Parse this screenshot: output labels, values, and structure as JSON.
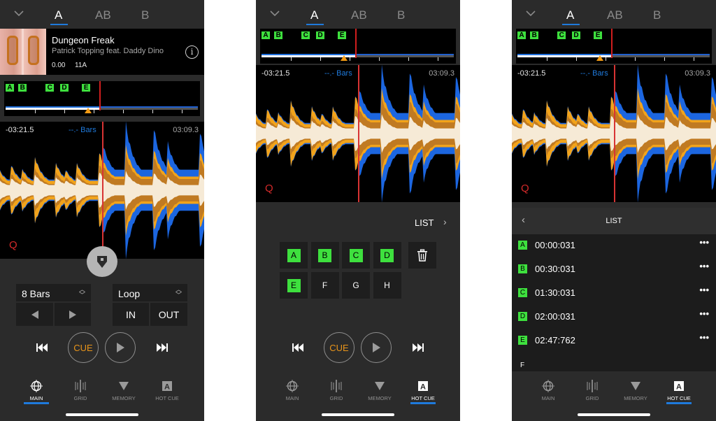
{
  "deck_tabs": {
    "collapse_icon": "chevron-down-icon",
    "tabs": [
      "A",
      "AB",
      "B"
    ],
    "active": "A"
  },
  "track": {
    "title": "Dungeon Freak",
    "artist": "Patrick Topping feat. Daddy Dino",
    "bpm": "0.00",
    "key": "11A",
    "info_icon": "info-icon"
  },
  "overview": {
    "hot_cues": [
      "A",
      "B",
      "C",
      "D",
      "E"
    ],
    "progress": 0.485
  },
  "waveform": {
    "elapsed": "-03:21.5",
    "bars": "--.- Bars",
    "remaining": "03:09.3",
    "quantize": "Q"
  },
  "main_panel": {
    "beat_select": "8 Bars",
    "loop_select": "Loop",
    "loop_in": "IN",
    "loop_out": "OUT"
  },
  "transport": {
    "cue": "CUE"
  },
  "nav": {
    "items": [
      {
        "label": "MAIN",
        "icon": "globe-icon"
      },
      {
        "label": "GRID",
        "icon": "grid-icon"
      },
      {
        "label": "MEMORY",
        "icon": "memory-triangle-icon"
      },
      {
        "label": "HOT CUE",
        "icon": "hot-cue-icon",
        "glyph": "A"
      }
    ]
  },
  "screens": [
    {
      "active_nav": "MAIN"
    },
    {
      "active_nav": "HOT CUE"
    },
    {
      "active_nav": "HOT CUE"
    }
  ],
  "hotcue_panel": {
    "list_label": "LIST",
    "pads": [
      {
        "label": "A",
        "set": true
      },
      {
        "label": "B",
        "set": true
      },
      {
        "label": "C",
        "set": true
      },
      {
        "label": "D",
        "set": true
      },
      {
        "label": "E",
        "set": true
      },
      {
        "label": "F",
        "set": false
      },
      {
        "label": "G",
        "set": false
      },
      {
        "label": "H",
        "set": false
      }
    ],
    "delete_icon": "trash-icon"
  },
  "list_panel": {
    "title": "LIST",
    "rows": [
      {
        "label": "A",
        "time": "00:00:031",
        "more": "•••"
      },
      {
        "label": "B",
        "time": "00:30:031",
        "more": "•••"
      },
      {
        "label": "C",
        "time": "01:30:031",
        "more": "•••"
      },
      {
        "label": "D",
        "time": "02:00:031",
        "more": "•••"
      },
      {
        "label": "E",
        "time": "02:47:762",
        "more": "•••"
      }
    ],
    "empty_row": "F"
  },
  "colors": {
    "accent_blue": "#1f7adc",
    "hot_cue_green": "#3ee03e",
    "cue_orange": "#e8941a",
    "playhead_red": "#d83434"
  }
}
